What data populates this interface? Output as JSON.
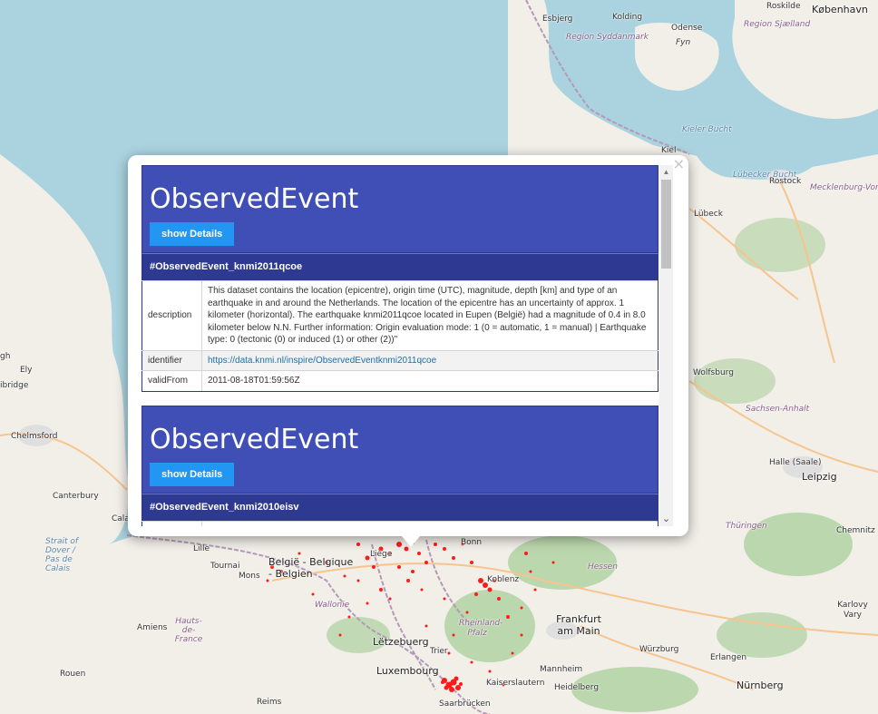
{
  "map": {
    "labels": {
      "esbjerg": "Esbjerg",
      "kolding": "Kolding",
      "odense": "Odense",
      "fyn": "Fyn",
      "roskilde": "Roskilde",
      "kobenhavn": "København",
      "region_syddanmark": "Region Syddanmark",
      "region_sjaelland": "Region Sjælland",
      "kiel": "Kiel",
      "kieler_bucht": "Kieler Bucht",
      "lubecker_bucht": "Lübecker Bucht",
      "rostock": "Rostock",
      "mecklenburg": "Mecklenburg-Vorpommern",
      "lubeck": "Lübeck",
      "wolfsburg": "Wolfsburg",
      "sachsen_anhalt": "Sachsen-Anhalt",
      "halle": "Halle (Saale)",
      "leipzig": "Leipzig",
      "thuringen": "Thüringen",
      "chemnitz": "Chemnitz",
      "gh": "gh",
      "ely": "Ely",
      "cambridge": "Cambridge",
      "ibridge": "ibridge",
      "chelmsford": "Chelmsford",
      "canterbury": "Canterbury",
      "calais": "Calais",
      "strait": "Strait of Dover / Pas de Calais",
      "lille": "Lille",
      "tournai": "Tournai",
      "mons": "Mons",
      "belgie": "België - Belgique - Belgien",
      "wallonie": "Wallonie",
      "liege": "Liège",
      "bonn": "Bonn",
      "koblenz": "Koblenz",
      "hessen": "Hessen",
      "frankfurt": "Frankfurt am Main",
      "karlovy": "Karlovy Vary",
      "amiens": "Amiens",
      "hauts": "Hauts-de-France",
      "letzebuerg": "Lëtzebuerg",
      "trier": "Trier",
      "rheinland": "Rheinland-Pfalz",
      "wurzburg": "Würzburg",
      "luxembourg": "Luxembourg",
      "mannheim": "Mannheim",
      "erlangen": "Erlangen",
      "rouen": "Rouen",
      "kaiserslautern": "Kaiserslautern",
      "heidelberg": "Heidelberg",
      "nurnberg": "Nürnberg",
      "reims": "Reims",
      "saarbrucken": "Saarbrücken"
    }
  },
  "popup": {
    "close_label": "×",
    "events": [
      {
        "title": "ObservedEvent",
        "button": "show Details",
        "id": "#ObservedEvent_knmi2011qcoe",
        "rows": [
          {
            "key": "description",
            "value": "This dataset contains the location (epicentre), origin time (UTC), magnitude, depth [km] and type of an earthquake in and around the Netherlands. The location of the epicentre has an uncertainty of approx. 1 kilometer (horizontal). The earthquake knmi2011qcoe located in Eupen (België) had a magnitude of 0.4 in 8.0 kilometer below N.N. Further information: Origin evaluation mode: 1 (0 = automatic, 1 = manual) | Earthquake type: 0 (tectonic (0) or induced (1) or other (2))\""
          },
          {
            "key": "identifier",
            "value": "https://data.knmi.nl/inspire/ObservedEventknmi2011qcoe"
          },
          {
            "key": "validFrom",
            "value": "2011-08-18T01:59:56Z"
          }
        ]
      },
      {
        "title": "ObservedEvent",
        "button": "show Details",
        "id": "#ObservedEvent_knmi2010eisv"
      }
    ]
  }
}
